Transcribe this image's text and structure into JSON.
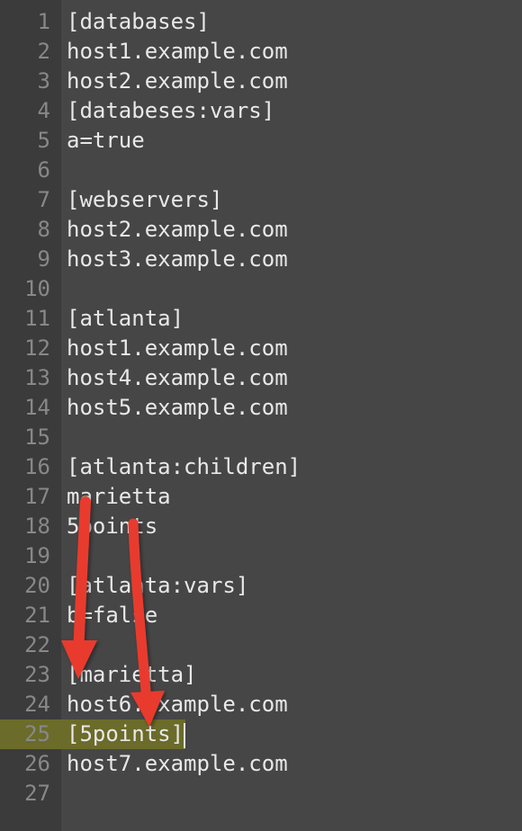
{
  "editor": {
    "current_line_number": 25,
    "lines": [
      {
        "num": 1,
        "text": "[databases]"
      },
      {
        "num": 2,
        "text": "host1.example.com"
      },
      {
        "num": 3,
        "text": "host2.example.com"
      },
      {
        "num": 4,
        "text": "[databeses:vars]"
      },
      {
        "num": 5,
        "text": "a=true"
      },
      {
        "num": 6,
        "text": ""
      },
      {
        "num": 7,
        "text": "[webservers]"
      },
      {
        "num": 8,
        "text": "host2.example.com"
      },
      {
        "num": 9,
        "text": "host3.example.com"
      },
      {
        "num": 10,
        "text": ""
      },
      {
        "num": 11,
        "text": "[atlanta]"
      },
      {
        "num": 12,
        "text": "host1.example.com"
      },
      {
        "num": 13,
        "text": "host4.example.com"
      },
      {
        "num": 14,
        "text": "host5.example.com"
      },
      {
        "num": 15,
        "text": ""
      },
      {
        "num": 16,
        "text": "[atlanta:children]"
      },
      {
        "num": 17,
        "text": "marietta"
      },
      {
        "num": 18,
        "text": "5points"
      },
      {
        "num": 19,
        "text": ""
      },
      {
        "num": 20,
        "text": "[atlanta:vars]"
      },
      {
        "num": 21,
        "text": "b=false"
      },
      {
        "num": 22,
        "text": ""
      },
      {
        "num": 23,
        "text": "[marietta]"
      },
      {
        "num": 24,
        "text": "host6.example.com"
      },
      {
        "num": 25,
        "text": "[5points]"
      },
      {
        "num": 26,
        "text": "host7.example.com"
      },
      {
        "num": 27,
        "text": ""
      }
    ]
  },
  "annotations": {
    "arrows": [
      {
        "from_line": 17,
        "to_line": 23,
        "color": "#e83b2e"
      },
      {
        "from_line": 18,
        "to_line": 25,
        "color": "#e83b2e"
      }
    ]
  }
}
